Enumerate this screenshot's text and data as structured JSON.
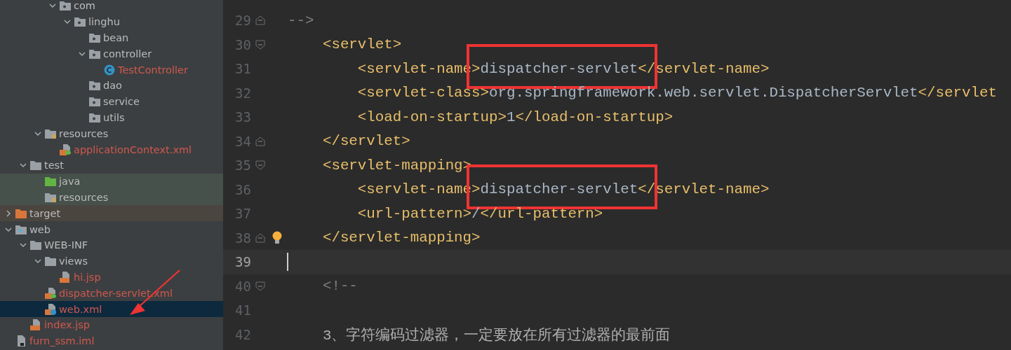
{
  "project_tree": {
    "items": [
      {
        "kind": "hidden",
        "children": [
          {
            "kind": "hidden",
            "children": [
              {
                "kind": "hidden",
                "children": [
                  {
                    "name": "com",
                    "kind": "package",
                    "expanded": true,
                    "unversioned": false,
                    "children": [
                      {
                        "name": "linghu",
                        "kind": "package",
                        "expanded": true,
                        "unversioned": false,
                        "children": [
                          {
                            "name": "bean",
                            "kind": "package",
                            "unversioned": false
                          },
                          {
                            "name": "controller",
                            "kind": "package",
                            "expanded": true,
                            "unversioned": false,
                            "children": [
                              {
                                "name": "TestController",
                                "kind": "class",
                                "unversioned": true,
                                "selected": false
                              }
                            ]
                          },
                          {
                            "name": "dao",
                            "kind": "package",
                            "unversioned": false
                          },
                          {
                            "name": "service",
                            "kind": "package",
                            "unversioned": false
                          },
                          {
                            "name": "utils",
                            "kind": "package",
                            "unversioned": false
                          }
                        ]
                      }
                    ]
                  }
                ]
              },
              {
                "name": "resources",
                "kind": "resources",
                "expanded": true,
                "unversioned": false,
                "children": [
                  {
                    "name": "applicationContext.xml",
                    "kind": "spring-xml",
                    "unversioned": true,
                    "selected": false
                  }
                ]
              }
            ]
          },
          {
            "name": "test",
            "kind": "folder",
            "expanded": true,
            "unversioned": false,
            "children": [
              {
                "name": "java",
                "kind": "test-source",
                "unversioned": false
              },
              {
                "name": "resources",
                "kind": "test-resources",
                "unversioned": false
              }
            ]
          }
        ]
      },
      {
        "name": "target",
        "kind": "excluded",
        "expanded": false,
        "unversioned": false
      },
      {
        "name": "web",
        "kind": "web",
        "expanded": true,
        "unversioned": false,
        "children": [
          {
            "name": "WEB-INF",
            "kind": "folder",
            "expanded": true,
            "unversioned": false,
            "children": [
              {
                "name": "views",
                "kind": "folder",
                "expanded": true,
                "unversioned": false,
                "children": [
                  {
                    "name": "hi.jsp",
                    "kind": "jsp",
                    "unversioned": true,
                    "selected": false
                  }
                ]
              },
              {
                "name": "dispatcher-servlet.xml",
                "kind": "spring-xml",
                "unversioned": true,
                "selected": false
              },
              {
                "name": "web.xml",
                "kind": "web-xml",
                "unversioned": true,
                "selected": true
              }
            ]
          },
          {
            "name": "index.jsp",
            "kind": "jsp",
            "unversioned": true,
            "selected": false
          }
        ]
      },
      {
        "name": "furn_ssm.iml",
        "kind": "iml",
        "unversioned": true,
        "selected": false
      }
    ],
    "annotations": [
      {
        "kind": "arrow"
      }
    ]
  },
  "editor": {
    "lines": [
      {
        "number": "29",
        "fold_end": true,
        "tokens": [
          {
            "kind": "comment",
            "text": "-->"
          }
        ]
      },
      {
        "number": "30",
        "fold_start": true,
        "tokens": [
          {
            "kind": "tag",
            "text": "    <servlet>"
          }
        ]
      },
      {
        "number": "31",
        "tokens": [
          {
            "kind": "tag",
            "text": "        <servlet-name>"
          },
          {
            "kind": "text",
            "text": "dispatcher-servlet",
            "boxed": true
          },
          {
            "kind": "tag",
            "text": "</servlet-name>"
          }
        ]
      },
      {
        "number": "32",
        "tokens": [
          {
            "kind": "tag",
            "text": "        <servlet-class>"
          },
          {
            "kind": "text",
            "text": "org.springframework.web.servlet.DispatcherServlet"
          },
          {
            "kind": "tag",
            "text": "</servlet"
          }
        ]
      },
      {
        "number": "33",
        "tokens": [
          {
            "kind": "tag",
            "text": "        <load-on-startup>"
          },
          {
            "kind": "text",
            "text": "1"
          },
          {
            "kind": "tag",
            "text": "</load-on-startup>"
          }
        ]
      },
      {
        "number": "34",
        "fold_end": true,
        "tokens": [
          {
            "kind": "tag",
            "text": "    </servlet>"
          }
        ]
      },
      {
        "number": "35",
        "fold_start": true,
        "tokens": [
          {
            "kind": "tag",
            "text": "    <servlet-mapping>"
          }
        ]
      },
      {
        "number": "36",
        "tokens": [
          {
            "kind": "tag",
            "text": "        <servlet-name>"
          },
          {
            "kind": "text",
            "text": "dispatcher-servlet",
            "boxed": true
          },
          {
            "kind": "tag",
            "text": "</servlet-name>"
          }
        ]
      },
      {
        "number": "37",
        "tokens": [
          {
            "kind": "tag",
            "text": "        <url-pattern>"
          },
          {
            "kind": "text",
            "text": "/"
          },
          {
            "kind": "tag",
            "text": "</url-pattern>"
          }
        ]
      },
      {
        "number": "38",
        "fold_end": true,
        "bulb": true,
        "tokens": [
          {
            "kind": "tag",
            "text": "    </servlet-mapping>"
          }
        ]
      },
      {
        "number": "39",
        "current": true
      },
      {
        "number": "40",
        "fold_start": true,
        "tokens": [
          {
            "kind": "comment",
            "text": "    <!--"
          }
        ]
      },
      {
        "number": "41"
      },
      {
        "number": "42",
        "tokens": [
          {
            "kind": "doc",
            "text": "    3、字符编码过滤器，一定要放在所有过滤器的最前面"
          }
        ]
      }
    ]
  }
}
